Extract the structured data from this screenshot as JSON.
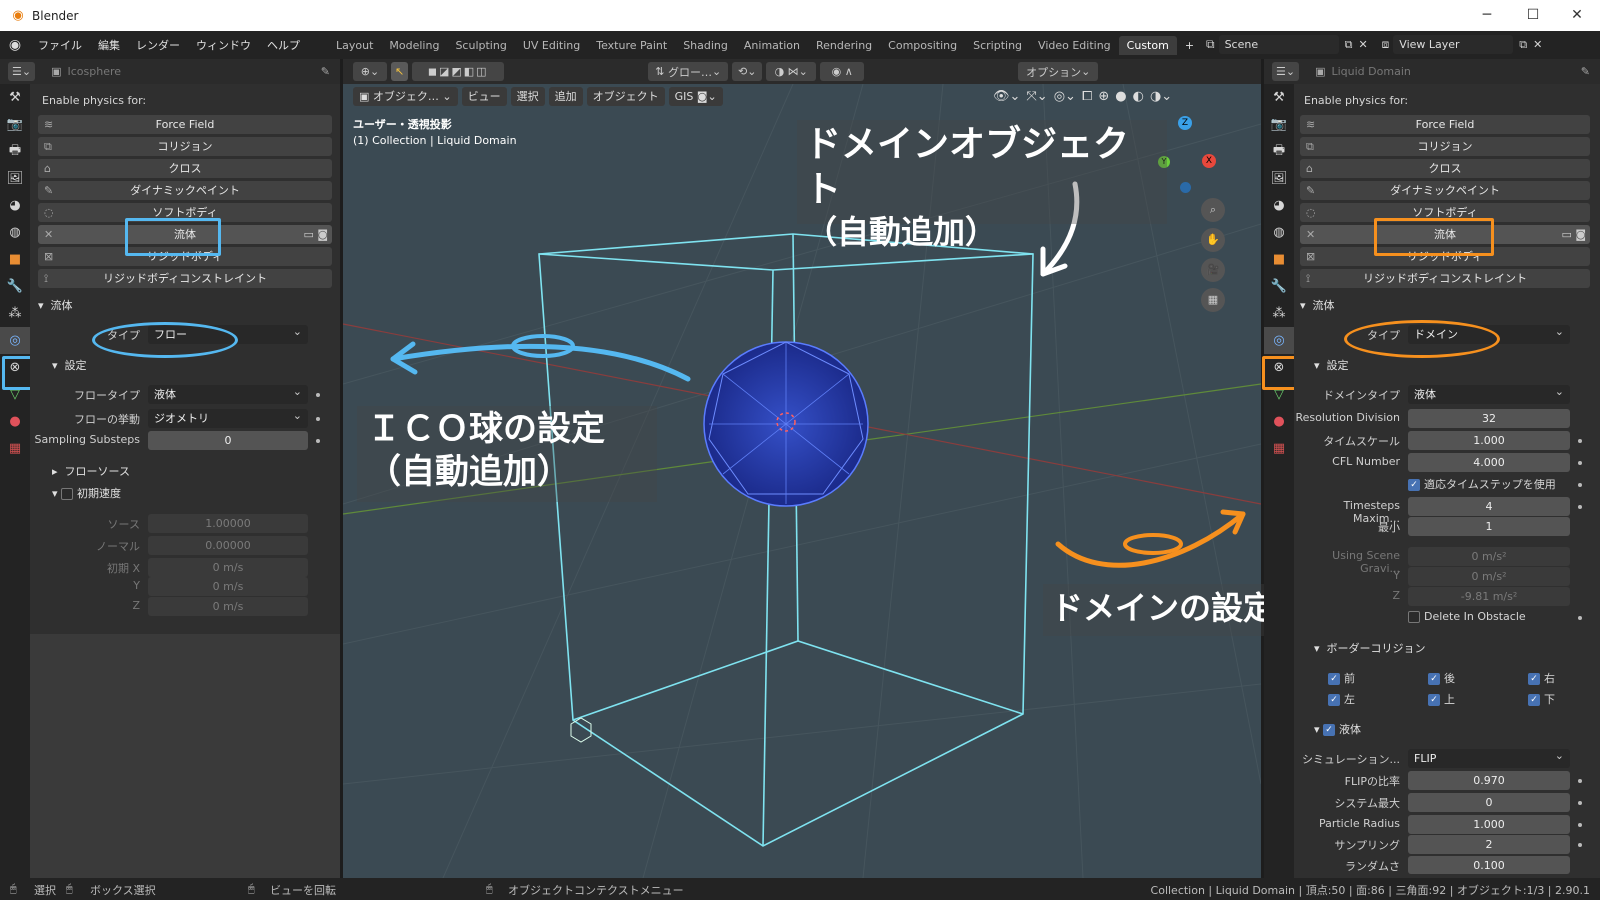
{
  "window": {
    "title": "Blender",
    "minimize": "─",
    "maximize": "☐",
    "close": "✕"
  },
  "menu": [
    "ファイル",
    "編集",
    "レンダー",
    "ウィンドウ",
    "ヘルプ"
  ],
  "workspaces": [
    "Layout",
    "Modeling",
    "Sculpting",
    "UV Editing",
    "Texture Paint",
    "Shading",
    "Animation",
    "Rendering",
    "Compositing",
    "Scripting",
    "Video Editing",
    "Custom"
  ],
  "active_workspace": "Custom",
  "add_workspace": "+",
  "scene": {
    "label": "Scene",
    "view_layer": "View Layer"
  },
  "left_panel": {
    "object_name": "Icosphere",
    "enable_label": "Enable physics for:",
    "physics_buttons": [
      "Force Field",
      "コリジョン",
      "クロス",
      "ダイナミックペイント",
      "ソフトボディ",
      "流体",
      "リジッドボディ",
      "リジッドボディコンストレイント"
    ],
    "fluid_header": "流体",
    "type_label": "タイプ",
    "type_value": "フロー",
    "settings_header": "設定",
    "rows": [
      {
        "label": "フロータイプ",
        "value": "液体",
        "kind": "select"
      },
      {
        "label": "フローの挙動",
        "value": "ジオメトリ",
        "kind": "select"
      },
      {
        "label": "Sampling Substeps",
        "value": "0",
        "kind": "input"
      }
    ],
    "flow_source": "フローソース",
    "initial_velocity": "初期速度",
    "vel_rows": [
      {
        "label": "ソース",
        "value": "1.00000"
      },
      {
        "label": "ノーマル",
        "value": "0.00000"
      },
      {
        "label": "初期 X",
        "value": "0 m/s"
      },
      {
        "label": "Y",
        "value": "0 m/s"
      },
      {
        "label": "Z",
        "value": "0 m/s"
      }
    ]
  },
  "viewport": {
    "header_buttons": [
      "オブジェク…",
      "ビュー",
      "選択",
      "追加",
      "オブジェクト",
      "GIS"
    ],
    "transform": "グロー…",
    "options": "オプション",
    "overlay_title": "ユーザー・透視投影",
    "overlay_collection": "(1) Collection | Liquid Domain",
    "annotation_domain_1": "ドメインオブジェクト",
    "annotation_domain_2": "（自動追加）",
    "annotation_ico_1": "ＩＣＯ球の設定",
    "annotation_ico_2": "（自動追加）",
    "annotation_domain_settings": "ドメインの設定",
    "gizmo": {
      "x": "X",
      "y": "Y",
      "z": "Z"
    }
  },
  "right_panel": {
    "object_name": "Liquid Domain",
    "enable_label": "Enable physics for:",
    "physics_buttons": [
      "Force Field",
      "コリジョン",
      "クロス",
      "ダイナミックペイント",
      "ソフトボディ",
      "流体",
      "リジッドボディ",
      "リジッドボディコンストレイント"
    ],
    "fluid_header": "流体",
    "type_label": "タイプ",
    "type_value": "ドメイン",
    "settings_header": "設定",
    "rows": [
      {
        "label": "ドメインタイプ",
        "value": "液体",
        "kind": "select"
      },
      {
        "label": "Resolution Division",
        "value": "32",
        "kind": "input"
      },
      {
        "label": "タイムスケール",
        "value": "1.000",
        "kind": "input"
      },
      {
        "label": "CFL Number",
        "value": "4.000",
        "kind": "input"
      }
    ],
    "adaptive_timesteps": "適応タイムステップを使用",
    "rows2": [
      {
        "label": "Timesteps Maxim...",
        "value": "4"
      },
      {
        "label": "最小",
        "value": "1"
      }
    ],
    "gravity_rows": [
      {
        "label": "Using Scene Gravi...",
        "value": "0 m/s²"
      },
      {
        "label": "Y",
        "value": "0 m/s²"
      },
      {
        "label": "Z",
        "value": "-9.81 m/s²"
      }
    ],
    "delete_in_obstacle": "Delete In Obstacle",
    "border_collision": "ボーダーコリジョン",
    "border_checks": [
      "前",
      "後",
      "右",
      "左",
      "上",
      "下"
    ],
    "liquid": "液体",
    "rows3": [
      {
        "label": "シミュレーション...",
        "value": "FLIP",
        "kind": "select"
      },
      {
        "label": "FLIPの比率",
        "value": "0.970",
        "kind": "input"
      },
      {
        "label": "システム最大",
        "value": "0",
        "kind": "input"
      },
      {
        "label": "Particle Radius",
        "value": "1.000",
        "kind": "input"
      },
      {
        "label": "サンプリング",
        "value": "2",
        "kind": "input"
      },
      {
        "label": "ランダムさ",
        "value": "0.100",
        "kind": "input"
      }
    ]
  },
  "statusbar": {
    "select": "選択",
    "box_select": "ボックス選択",
    "rotate_view": "ビューを回転",
    "context_menu": "オブジェクトコンテクストメニュー",
    "stats": "Collection | Liquid Domain | 頂点:50 | 面:86 | 三角面:92 | オブジェクト:1/3 | 2.90.1"
  },
  "colors": {
    "accent_blue": "#55b8f0",
    "accent_orange": "#f6901e",
    "viewport_bg": "#3b4a53",
    "wire": "#7fe3f0"
  }
}
